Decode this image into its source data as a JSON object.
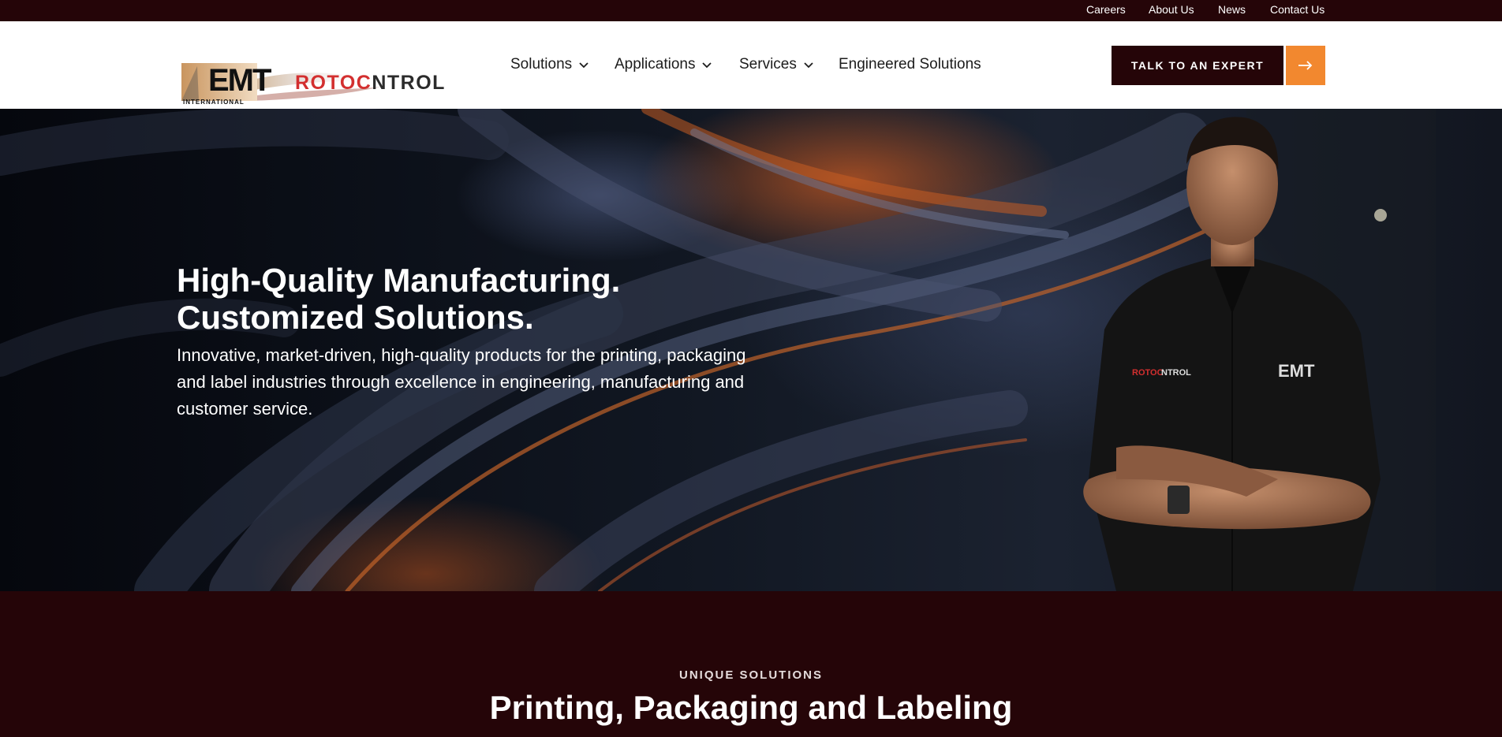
{
  "topbar": {
    "links": [
      "Careers",
      "About Us",
      "News",
      "Contact Us"
    ]
  },
  "header": {
    "logo": {
      "brand_left": "EMT",
      "brand_left_sub": "INTERNATIONAL",
      "brand_right_red": "ROTOC",
      "brand_right_dark": "NTROL"
    },
    "nav": [
      {
        "label": "Solutions",
        "dropdown": true
      },
      {
        "label": "Applications",
        "dropdown": true
      },
      {
        "label": "Services",
        "dropdown": true
      },
      {
        "label": "Engineered Solutions",
        "dropdown": false
      }
    ],
    "cta_label": "TALK TO AN EXPERT",
    "cta_arrow_icon": "arrow-right-icon"
  },
  "hero": {
    "title_line1": "High-Quality Manufacturing.",
    "title_line2": "Customized Solutions.",
    "subtitle": "Innovative, market-driven, high-quality products for the printing, packaging and label industries through excellence in engineering, manufacturing and customer service."
  },
  "section": {
    "eyebrow": "UNIQUE SOLUTIONS",
    "title": "Printing, Packaging and Labeling"
  },
  "colors": {
    "dark_maroon": "#250508",
    "accent_orange": "#f2882f",
    "brand_red": "#d32f2f"
  }
}
